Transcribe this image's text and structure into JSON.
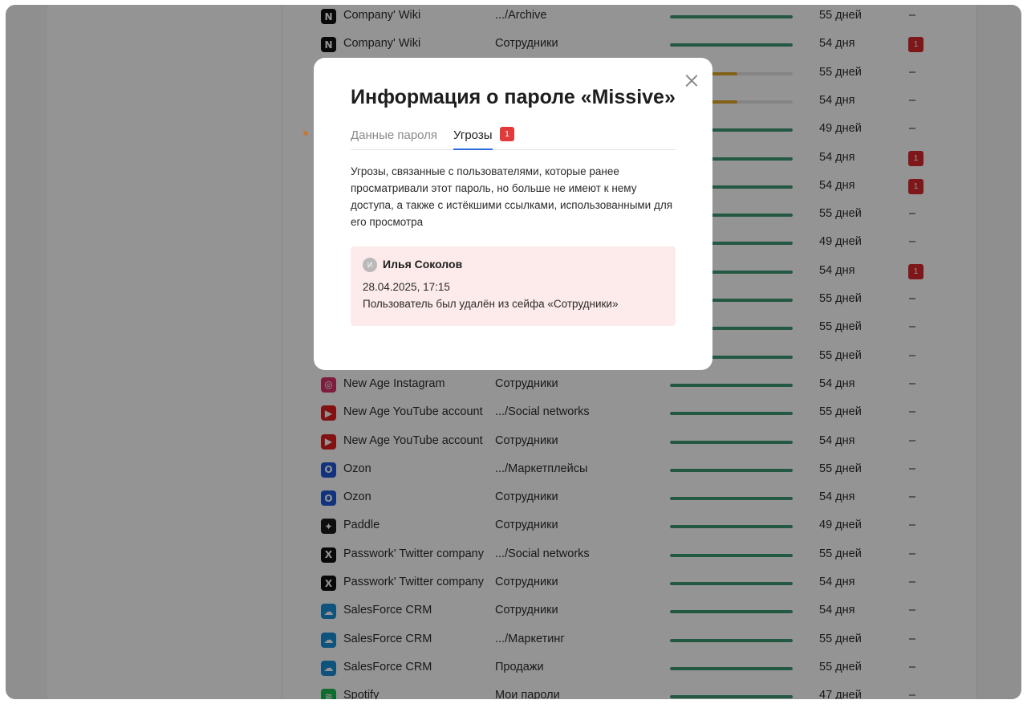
{
  "modal": {
    "title": "Информация о пароле «Missive»",
    "tabs": [
      {
        "label": "Данные пароля",
        "active": false
      },
      {
        "label": "Угрозы",
        "active": true,
        "badge": "1"
      }
    ],
    "description": "Угрозы, связанные с пользователями, которые ранее просматривали этот пароль, но больше не имеют к нему доступа, а также с истёкшими ссылками, использованными для его просмотра",
    "threat": {
      "avatar_initial": "И",
      "user": "Илья Соколов",
      "datetime": "28.04.2025, 17:15",
      "event": "Пользователь был удалён из сейфа «Сотрудники»"
    },
    "close_icon": "close-icon"
  },
  "colors": {
    "strength_good": "#3d9a72",
    "strength_medium": "#e0a526",
    "threat_badge": "#d7282e",
    "active_tab_underline": "#2d6cdf"
  },
  "rows": [
    {
      "icon": "notion-icon",
      "icon_glyph": "N",
      "icon_bg": "#111111",
      "name": "Company' Wiki",
      "folder": ".../Archive",
      "strength": 1.0,
      "age": "55 дней",
      "threats": "–"
    },
    {
      "icon": "notion-icon",
      "icon_glyph": "N",
      "icon_bg": "#111111",
      "name": "Company' Wiki",
      "folder": "Сотрудники",
      "strength": 1.0,
      "age": "54 дня",
      "threats": "1"
    },
    {
      "icon": "",
      "icon_glyph": "",
      "icon_bg": "",
      "name": "",
      "folder": "",
      "strength": 0.55,
      "age": "55 дней",
      "threats": "–"
    },
    {
      "icon": "",
      "icon_glyph": "",
      "icon_bg": "",
      "name": "",
      "folder": "",
      "strength": 0.55,
      "age": "54 дня",
      "threats": "–"
    },
    {
      "icon": "",
      "icon_glyph": "",
      "icon_bg": "",
      "name": "",
      "folder": "",
      "strength": 1.0,
      "age": "49 дней",
      "threats": "–"
    },
    {
      "icon": "",
      "icon_glyph": "",
      "icon_bg": "",
      "name": "",
      "folder": "",
      "strength": 1.0,
      "age": "54 дня",
      "threats": "1"
    },
    {
      "icon": "",
      "icon_glyph": "",
      "icon_bg": "",
      "name": "",
      "folder": "",
      "strength": 1.0,
      "age": "54 дня",
      "threats": "1"
    },
    {
      "icon": "",
      "icon_glyph": "",
      "icon_bg": "",
      "name": "",
      "folder": "",
      "strength": 1.0,
      "age": "55 дней",
      "threats": "–"
    },
    {
      "icon": "",
      "icon_glyph": "",
      "icon_bg": "",
      "name": "",
      "folder": "",
      "strength": 1.0,
      "age": "49 дней",
      "threats": "–"
    },
    {
      "icon": "",
      "icon_glyph": "",
      "icon_bg": "",
      "name": "",
      "folder": "",
      "strength": 1.0,
      "age": "54 дня",
      "threats": "1"
    },
    {
      "icon": "",
      "icon_glyph": "",
      "icon_bg": "",
      "name": "",
      "folder": "",
      "strength": 1.0,
      "age": "55 дней",
      "threats": "–"
    },
    {
      "icon": "",
      "icon_glyph": "",
      "icon_bg": "",
      "name": "",
      "folder": "",
      "strength": 1.0,
      "age": "55 дней",
      "threats": "–"
    },
    {
      "icon": "",
      "icon_glyph": "",
      "icon_bg": "",
      "name": "",
      "folder": "",
      "strength": 1.0,
      "age": "55 дней",
      "threats": "–"
    },
    {
      "icon": "instagram-icon",
      "icon_glyph": "◎",
      "icon_bg": "#d6336c",
      "name": "New Age Instagram",
      "folder": "Сотрудники",
      "strength": 1.0,
      "age": "54 дня",
      "threats": "–"
    },
    {
      "icon": "youtube-icon",
      "icon_glyph": "▶",
      "icon_bg": "#e02020",
      "name": "New Age YouTube account",
      "folder": ".../Social networks",
      "strength": 1.0,
      "age": "55 дней",
      "threats": "–"
    },
    {
      "icon": "youtube-icon",
      "icon_glyph": "▶",
      "icon_bg": "#e02020",
      "name": "New Age YouTube account",
      "folder": "Сотрудники",
      "strength": 1.0,
      "age": "54 дня",
      "threats": "–"
    },
    {
      "icon": "ozon-icon",
      "icon_glyph": "O",
      "icon_bg": "#1f57d6",
      "name": "Ozon",
      "folder": ".../Маркетплейсы",
      "strength": 1.0,
      "age": "55 дней",
      "threats": "–"
    },
    {
      "icon": "ozon-icon",
      "icon_glyph": "O",
      "icon_bg": "#1f57d6",
      "name": "Ozon",
      "folder": "Сотрудники",
      "strength": 1.0,
      "age": "54 дня",
      "threats": "–"
    },
    {
      "icon": "paddle-icon",
      "icon_glyph": "✦",
      "icon_bg": "#1b1b1b",
      "name": "Paddle",
      "folder": "Сотрудники",
      "strength": 1.0,
      "age": "49 дней",
      "threats": "–"
    },
    {
      "icon": "x-twitter-icon",
      "icon_glyph": "X",
      "icon_bg": "#111111",
      "name": "Passwork' Twitter company",
      "folder": ".../Social networks",
      "strength": 1.0,
      "age": "55 дней",
      "threats": "–"
    },
    {
      "icon": "x-twitter-icon",
      "icon_glyph": "X",
      "icon_bg": "#111111",
      "name": "Passwork' Twitter company",
      "folder": "Сотрудники",
      "strength": 1.0,
      "age": "54 дня",
      "threats": "–"
    },
    {
      "icon": "salesforce-icon",
      "icon_glyph": "☁",
      "icon_bg": "#1b8fd6",
      "name": "SalesForce CRM",
      "folder": "Сотрудники",
      "strength": 1.0,
      "age": "54 дня",
      "threats": "–"
    },
    {
      "icon": "salesforce-icon",
      "icon_glyph": "☁",
      "icon_bg": "#1b8fd6",
      "name": "SalesForce CRM",
      "folder": ".../Маркетинг",
      "strength": 1.0,
      "age": "55 дней",
      "threats": "–"
    },
    {
      "icon": "salesforce-icon",
      "icon_glyph": "☁",
      "icon_bg": "#1b8fd6",
      "name": "SalesForce CRM",
      "folder": "Продажи",
      "strength": 1.0,
      "age": "55 дней",
      "threats": "–"
    },
    {
      "icon": "spotify-icon",
      "icon_glyph": "≋",
      "icon_bg": "#1db954",
      "name": "Spotify",
      "folder": "Мои пароли",
      "strength": 1.0,
      "age": "47 дней",
      "threats": "–"
    }
  ]
}
